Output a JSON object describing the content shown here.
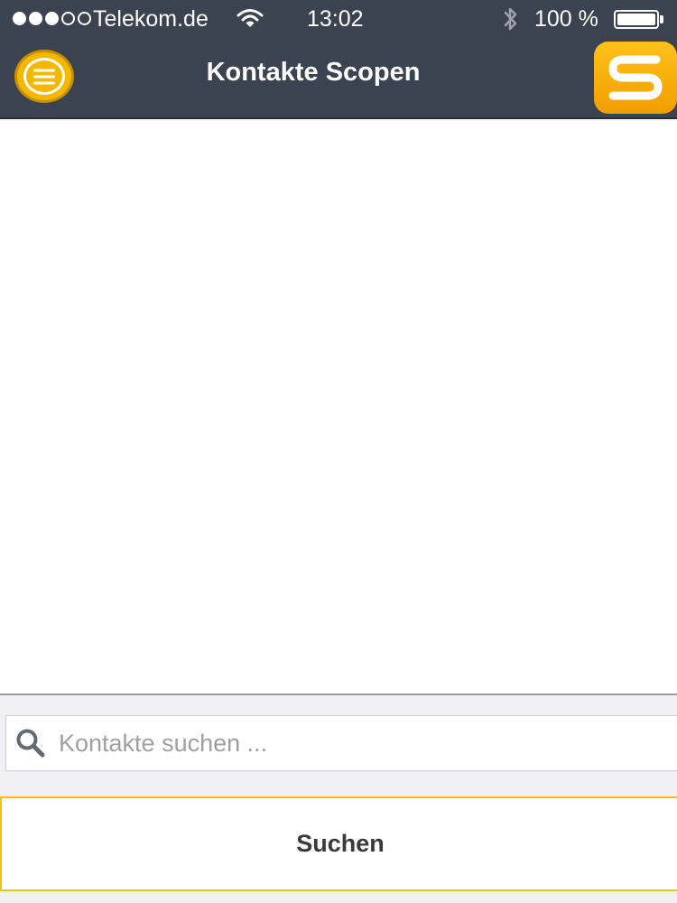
{
  "status_bar": {
    "carrier": "Telekom.de",
    "time": "13:02",
    "battery_text": "100 %",
    "battery_level": 1.0,
    "signal_bars_filled": 3,
    "signal_bars_total": 5,
    "icons": [
      "wifi-icon",
      "bluetooth-icon",
      "battery-icon"
    ]
  },
  "header": {
    "title": "Kontakte Scopen",
    "menu_icon": "hamburger-menu-icon",
    "logo_icon": "s-logo-icon"
  },
  "search": {
    "placeholder": "Kontakte suchen ...",
    "value": "",
    "icon": "search-icon",
    "button_label": "Suchen"
  },
  "colors": {
    "header_bg": "#3b4250",
    "accent": "#f5b800",
    "panel_bg": "#efeff4",
    "button_border": "#f0c020"
  }
}
